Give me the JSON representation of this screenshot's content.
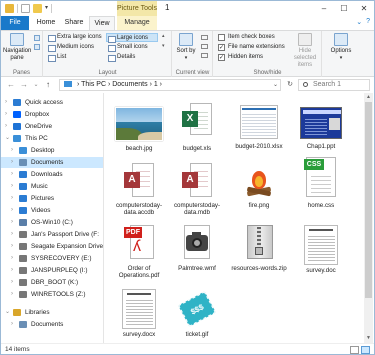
{
  "title_bar": {
    "context_tab": "Picture Tools",
    "window_title": "1",
    "controls": [
      "–",
      "☐",
      "✕"
    ]
  },
  "ribbon_tabs": {
    "file": "File",
    "home": "Home",
    "share": "Share",
    "view": "View",
    "manage": "Manage"
  },
  "ribbon": {
    "panes": {
      "navigation_pane": "Navigation pane",
      "label": "Panes"
    },
    "layout": {
      "items": [
        "Extra large icons",
        "Large icons",
        "Medium icons",
        "Small icons",
        "List",
        "Details"
      ],
      "selected": "Large icons",
      "label": "Layout"
    },
    "current_view": {
      "sort_by": "Sort by",
      "label": "Current view"
    },
    "show_hide": {
      "item_check_boxes": "Item check boxes",
      "file_name_extensions": "File name extensions",
      "hidden_items": "Hidden items",
      "item_check_boxes_checked": false,
      "file_name_extensions_checked": true,
      "hidden_items_checked": true,
      "hide_selected": "Hide selected items",
      "label": "Show/hide"
    },
    "options": "Options"
  },
  "address": {
    "path": "›  This PC  ›  Documents  ›  1  ›",
    "search_placeholder": "Search 1"
  },
  "nav_pane": [
    {
      "label": "Quick access",
      "icon": "star-icon",
      "color": "#2b7cd3",
      "indent": 0,
      "chevron": "›"
    },
    {
      "label": "Dropbox",
      "icon": "dropbox-icon",
      "color": "#0061fe",
      "indent": 0,
      "chevron": "›"
    },
    {
      "label": "OneDrive",
      "icon": "cloud-icon",
      "color": "#1e73d6",
      "indent": 0,
      "chevron": "›"
    },
    {
      "label": "This PC",
      "icon": "computer-icon",
      "color": "#3a8fd8",
      "indent": 0,
      "chevron": "⌄"
    },
    {
      "label": "Desktop",
      "icon": "desktop-icon",
      "color": "#3a8fd8",
      "indent": 1,
      "chevron": "›"
    },
    {
      "label": "Documents",
      "icon": "documents-icon",
      "color": "#6a8fb5",
      "indent": 1,
      "chevron": "›",
      "selected": true
    },
    {
      "label": "Downloads",
      "icon": "downloads-icon",
      "color": "#2b7cd3",
      "indent": 1,
      "chevron": "›"
    },
    {
      "label": "Music",
      "icon": "music-icon",
      "color": "#2b7cd3",
      "indent": 1,
      "chevron": "›"
    },
    {
      "label": "Pictures",
      "icon": "pictures-icon",
      "color": "#2b7cd3",
      "indent": 1,
      "chevron": "›"
    },
    {
      "label": "Videos",
      "icon": "videos-icon",
      "color": "#2b7cd3",
      "indent": 1,
      "chevron": "›"
    },
    {
      "label": "OS-Win10 (C:)",
      "icon": "drive-icon",
      "color": "#5a7ea8",
      "indent": 1,
      "chevron": "›"
    },
    {
      "label": "Jan's Passport Drive (F:",
      "icon": "drive-icon",
      "color": "#777777",
      "indent": 1,
      "chevron": "›"
    },
    {
      "label": "Seagate Expansion Drive (F:",
      "icon": "drive-icon",
      "color": "#777777",
      "indent": 1,
      "chevron": "›"
    },
    {
      "label": "SYSRECOVERY (E:)",
      "icon": "drive-icon",
      "color": "#777777",
      "indent": 1,
      "chevron": "›"
    },
    {
      "label": "JANSPURPLEQ (I:)",
      "icon": "drive-icon",
      "color": "#777777",
      "indent": 1,
      "chevron": "›"
    },
    {
      "label": "DBR_BOOT (K:)",
      "icon": "drive-icon",
      "color": "#777777",
      "indent": 1,
      "chevron": "›"
    },
    {
      "label": "WINRETOOLS (Z:)",
      "icon": "drive-icon",
      "color": "#777777",
      "indent": 1,
      "chevron": "›"
    },
    {
      "label": "",
      "icon": "",
      "color": "",
      "indent": 0,
      "chevron": ""
    },
    {
      "label": "Libraries",
      "icon": "libraries-icon",
      "color": "#d9a62a",
      "indent": 0,
      "chevron": "⌄"
    },
    {
      "label": "Documents",
      "icon": "documents-icon",
      "color": "#6a8fb5",
      "indent": 1,
      "chevron": "›"
    }
  ],
  "files": [
    {
      "name": "beach.jpg",
      "icon": "beach-image-thumbnail"
    },
    {
      "name": "budget.xls",
      "icon": "excel-icon"
    },
    {
      "name": "budget-2010.xlsx",
      "icon": "spreadsheet-thumbnail"
    },
    {
      "name": "Chap1.ppt",
      "icon": "powerpoint-thumbnail"
    },
    {
      "name": "computerstoday-data.accdb",
      "icon": "access-icon"
    },
    {
      "name": "computerstoday-data.mdb",
      "icon": "access-icon"
    },
    {
      "name": "fire.png",
      "icon": "fire-image-thumbnail"
    },
    {
      "name": "home.css",
      "icon": "css-icon"
    },
    {
      "name": "Order of Operations.pdf",
      "icon": "pdf-icon"
    },
    {
      "name": "Palmtree.wmf",
      "icon": "camera-icon"
    },
    {
      "name": "resources-words.zip",
      "icon": "zip-icon"
    },
    {
      "name": "survey.doc",
      "icon": "document-thumbnail"
    },
    {
      "name": "survey.docx",
      "icon": "document-thumbnail"
    },
    {
      "name": "ticket.gif",
      "icon": "ticket-image-thumbnail"
    }
  ],
  "status": {
    "item_count": "14 items"
  }
}
